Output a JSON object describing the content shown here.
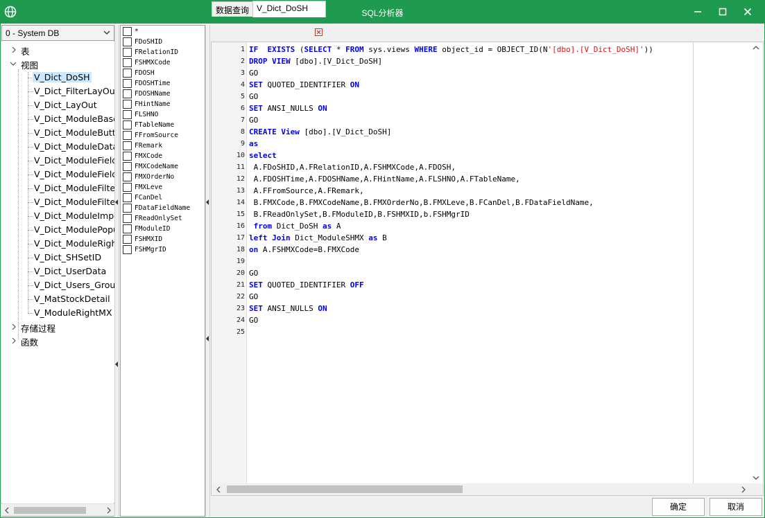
{
  "window": {
    "title": "SQL分析器",
    "title_color": "#1f9b4f"
  },
  "db_selector": {
    "value": "0 - System DB"
  },
  "tree": {
    "nodes": [
      {
        "label": "表",
        "expanded": false
      },
      {
        "label": "视图",
        "expanded": true
      },
      {
        "label": "存储过程",
        "expanded": false
      },
      {
        "label": "函数",
        "expanded": false
      }
    ],
    "views": [
      {
        "label": "V_Dict_DoSH",
        "selected": true
      },
      {
        "label": "V_Dict_FilterLayOut"
      },
      {
        "label": "V_Dict_LayOut"
      },
      {
        "label": "V_Dict_ModuleBase"
      },
      {
        "label": "V_Dict_ModuleButtc"
      },
      {
        "label": "V_Dict_ModuleData!"
      },
      {
        "label": "V_Dict_ModuleField"
      },
      {
        "label": "V_Dict_ModuleField_"
      },
      {
        "label": "V_Dict_ModuleFilter"
      },
      {
        "label": "V_Dict_ModuleFilter"
      },
      {
        "label": "V_Dict_ModuleImpc"
      },
      {
        "label": "V_Dict_ModulePopu"
      },
      {
        "label": "V_Dict_ModuleRight"
      },
      {
        "label": "V_Dict_SHSetID"
      },
      {
        "label": "V_Dict_UserData"
      },
      {
        "label": "V_Dict_Users_Group"
      },
      {
        "label": "V_MatStockDetail"
      },
      {
        "label": "V_ModuleRightMX"
      }
    ]
  },
  "fields": [
    "*",
    "FDoSHID",
    "FRelationID",
    "FSHMXCode",
    "FDOSH",
    "FDOSHTime",
    "FDOSHName",
    "FHintName",
    "FLSHNO",
    "FTableName",
    "FFromSource",
    "FRemark",
    "FMXCode",
    "FMXCodeName",
    "FMXOrderNo",
    "FMXLeve",
    "FCanDel",
    "FDataFieldName",
    "FReadOnlySet",
    "FModuleID",
    "FSHMXID",
    "FSHMgrID"
  ],
  "tabs": [
    {
      "label": "数据查询",
      "active": false
    },
    {
      "label": "V_Dict_DoSH",
      "active": true
    }
  ],
  "editor": {
    "line_numbers": [
      "1",
      "2",
      "3",
      "4",
      "5",
      "6",
      "7",
      "8",
      "9",
      "10",
      "11",
      "12",
      "13",
      "14",
      "15",
      "16",
      "17",
      "18",
      "19",
      "20",
      "21",
      "22",
      "23",
      "24",
      "25"
    ],
    "lines": [
      [
        {
          "t": "IF  EXISTS ",
          "k": 1
        },
        {
          "t": "(",
          "k": 0
        },
        {
          "t": "SELECT",
          "k": 1
        },
        {
          "t": " * ",
          "k": 0
        },
        {
          "t": "FROM",
          "k": 1
        },
        {
          "t": " sys.views ",
          "k": 0
        },
        {
          "t": "WHERE",
          "k": 1
        },
        {
          "t": " object_id = OBJECT_ID(N",
          "k": 0
        },
        {
          "t": "'[dbo].[V_Dict_DoSH]'",
          "k": 2
        },
        {
          "t": "))",
          "k": 0
        }
      ],
      [
        {
          "t": "DROP VIEW",
          "k": 1
        },
        {
          "t": " [dbo].[V_Dict_DoSH]",
          "k": 0
        }
      ],
      [
        {
          "t": "GO",
          "k": 0
        }
      ],
      [
        {
          "t": "SET",
          "k": 1
        },
        {
          "t": " QUOTED_IDENTIFIER ",
          "k": 0
        },
        {
          "t": "ON",
          "k": 1
        }
      ],
      [
        {
          "t": "GO",
          "k": 0
        }
      ],
      [
        {
          "t": "SET",
          "k": 1
        },
        {
          "t": " ANSI_NULLS ",
          "k": 0
        },
        {
          "t": "ON",
          "k": 1
        }
      ],
      [
        {
          "t": "GO",
          "k": 0
        }
      ],
      [
        {
          "t": "CREATE View",
          "k": 1
        },
        {
          "t": " [dbo].[V_Dict_DoSH]",
          "k": 0
        }
      ],
      [
        {
          "t": "as",
          "k": 1
        }
      ],
      [
        {
          "t": "select",
          "k": 1
        }
      ],
      [
        {
          "t": " A.FDoSHID,A.FRelationID,A.FSHMXCode,A.FDOSH,",
          "k": 0
        }
      ],
      [
        {
          "t": " A.FDOSHTime,A.FDOSHName,A.FHintName,A.FLSHNO,A.FTableName,",
          "k": 0
        }
      ],
      [
        {
          "t": " A.FFromSource,A.FRemark,",
          "k": 0
        }
      ],
      [
        {
          "t": " B.FMXCode,B.FMXCodeName,B.FMXOrderNo,B.FMXLeve,B.FCanDel,B.FDataFieldName,",
          "k": 0
        }
      ],
      [
        {
          "t": " B.FReadOnlySet,B.FModuleID,B.FSHMXID,b.FSHMgrID",
          "k": 0
        }
      ],
      [
        {
          "t": " from",
          "k": 1
        },
        {
          "t": " Dict_DoSH ",
          "k": 0
        },
        {
          "t": "as",
          "k": 1
        },
        {
          "t": " A",
          "k": 0
        }
      ],
      [
        {
          "t": "left Join",
          "k": 1
        },
        {
          "t": " Dict_ModuleSHMX ",
          "k": 0
        },
        {
          "t": "as",
          "k": 1
        },
        {
          "t": " B",
          "k": 0
        }
      ],
      [
        {
          "t": "on",
          "k": 1
        },
        {
          "t": " A.FSHMXCode=B.FMXCode",
          "k": 0
        }
      ],
      [],
      [
        {
          "t": "GO",
          "k": 0
        }
      ],
      [
        {
          "t": "SET",
          "k": 1
        },
        {
          "t": " QUOTED_IDENTIFIER ",
          "k": 0
        },
        {
          "t": "OFF",
          "k": 1
        }
      ],
      [
        {
          "t": "GO",
          "k": 0
        }
      ],
      [
        {
          "t": "SET",
          "k": 1
        },
        {
          "t": " ANSI_NULLS ",
          "k": 0
        },
        {
          "t": "ON",
          "k": 1
        }
      ],
      [
        {
          "t": "GO",
          "k": 0
        }
      ],
      []
    ]
  },
  "buttons": {
    "ok": "确定",
    "cancel": "取消"
  }
}
